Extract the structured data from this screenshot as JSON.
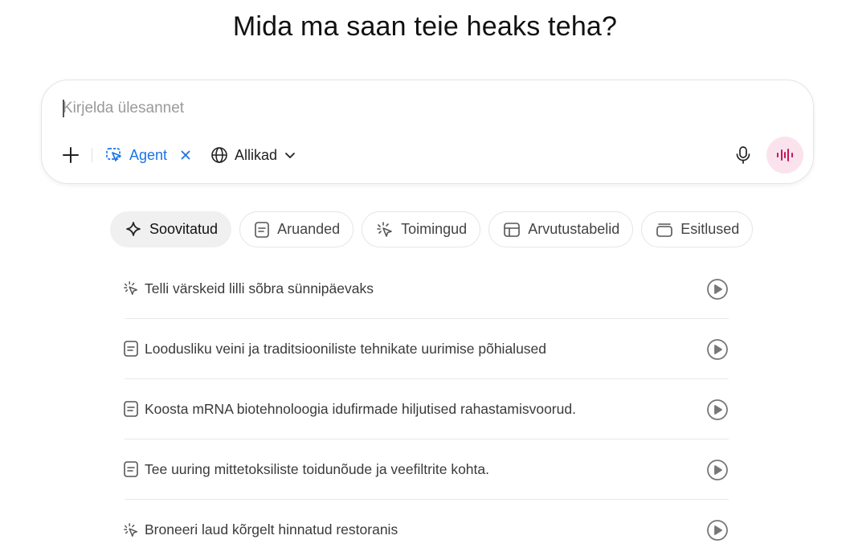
{
  "header": {
    "title": "Mida ma saan teie heaks teha?"
  },
  "composer": {
    "placeholder": "Kirjelda ülesannet",
    "agent_label": "Agent",
    "sources_label": "Allikad"
  },
  "tabs": [
    {
      "label": "Soovitatud",
      "icon": "sparkle-icon",
      "active": true
    },
    {
      "label": "Aruanded",
      "icon": "document-icon"
    },
    {
      "label": "Toimingud",
      "icon": "cursor-click-icon"
    },
    {
      "label": "Arvutustabelid",
      "icon": "table-icon"
    },
    {
      "label": "Esitlused",
      "icon": "slides-icon"
    }
  ],
  "suggestions": [
    {
      "text": "Telli värskeid lilli sõbra sünnipäevaks",
      "icon": "cursor-click-icon"
    },
    {
      "text": "Loodusliku veini ja traditsiooniliste tehnikate uurimise põhialused",
      "icon": "document-icon"
    },
    {
      "text": "Koosta mRNA biotehnoloogia idufirmade hiljutised rahastamisvoorud.",
      "icon": "document-icon"
    },
    {
      "text": "Tee uuring mittetoksiliste toidunõude ja veefiltrite kohta.",
      "icon": "document-icon"
    },
    {
      "text": "Broneeri laud kõrgelt hinnatud restoranis",
      "icon": "cursor-click-icon"
    }
  ],
  "colors": {
    "accent": "#1a73e8",
    "voice_bg": "#fbe3ee",
    "voice_icon": "#c2185b"
  }
}
